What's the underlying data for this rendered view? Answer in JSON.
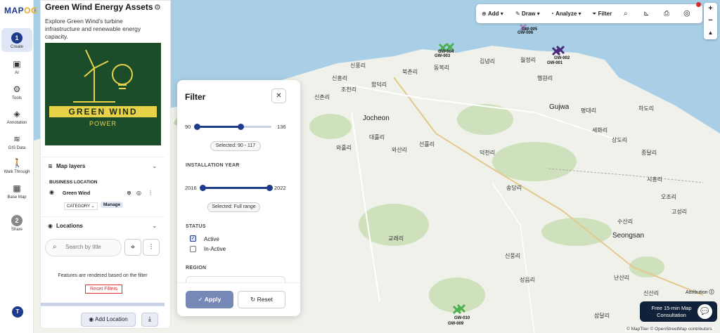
{
  "app": {
    "logo_a": "MAP",
    "logo_b": "OG"
  },
  "rail": {
    "items": [
      {
        "badge": "1",
        "label": "Create"
      },
      {
        "label": "AI"
      },
      {
        "label": "Tools"
      },
      {
        "label": "Annotation"
      },
      {
        "label": "GIS Data"
      },
      {
        "label": "Walk Through"
      },
      {
        "label": "Base Map"
      },
      {
        "badge": "2",
        "label": "Share"
      }
    ],
    "avatar": "T"
  },
  "panel": {
    "title": "Green Wind Energy Assets",
    "description": "Explore Green Wind's turbine infrastructure and renewable energy capacity.",
    "banner_text": "GREEN WIND",
    "banner_sub": "POWER",
    "map_layers": "Map layers",
    "business_location": "BUSINESS LOCATION",
    "layer_name": "Green Wind",
    "category": "CATEGORY",
    "manage": "Manage",
    "locations": "Locations",
    "search_placeholder": "Search by title",
    "filter_note": "Features are rendered based on the filter",
    "reset_filters": "Reset Filters",
    "add_location": "Add Location"
  },
  "filter": {
    "title": "Filter",
    "range1_min": "90",
    "range1_max": "136",
    "range1_selected": "Selected: 90 - 117",
    "range1_low": 90,
    "range1_high": 117,
    "year_label": "INSTALLATION YEAR",
    "year_min": "2016",
    "year_max": "2022",
    "year_selected": "Selected: Full range",
    "status_label": "STATUS",
    "status_active": "Active",
    "status_inactive": "In-Active",
    "region_label": "REGION",
    "apply": "Apply",
    "reset": "Reset"
  },
  "toolbar": {
    "add": "Add",
    "draw": "Draw",
    "analyze": "Analyze",
    "filter": "Filter"
  },
  "map": {
    "places": [
      "신풍리",
      "북촌리",
      "동복리",
      "김녕리",
      "월정리",
      "행원리",
      "신흥리",
      "함덕리",
      "조천리",
      "신촌리",
      "Jocheon",
      "대흘리",
      "와흘리",
      "와산리",
      "선흘리",
      "덕천리",
      "Gujwa",
      "평대리",
      "하도리",
      "세화리",
      "상도리",
      "종달리",
      "시흥리",
      "송당리",
      "오조리",
      "고성리",
      "수산리",
      "Seongsan",
      "교래리",
      "신풍리",
      "난산리",
      "성읍리",
      "삼달리",
      "신산리"
    ],
    "markers": [
      "GW-004",
      "GW-003",
      "GW-005",
      "GW-006",
      "GW-002",
      "GW-001",
      "GW-010",
      "GW-009"
    ],
    "attribution": "Attribution",
    "copyright": "© MapTiler © OpenStreetMap contributors"
  },
  "consult": {
    "text": "Free 15-min Map Consultation"
  }
}
